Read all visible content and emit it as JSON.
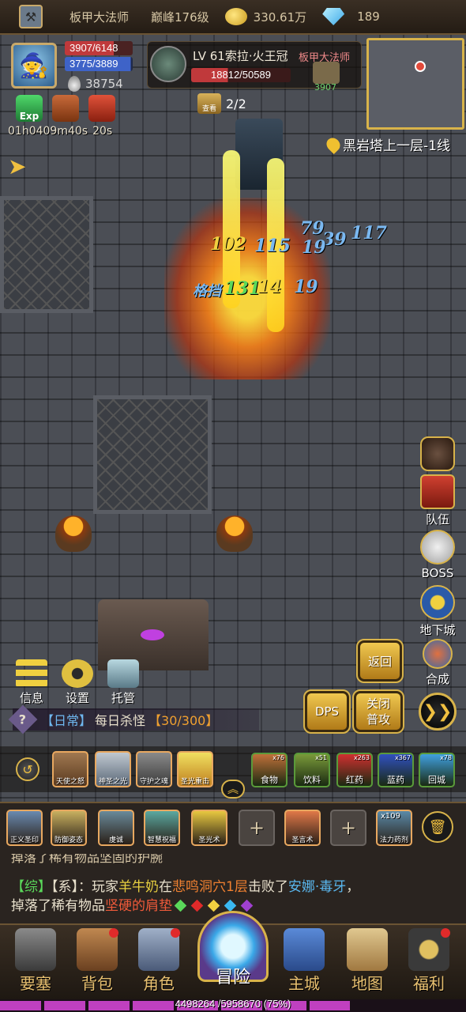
{
  "topbar": {
    "class_name": "板甲大法师",
    "peak_level": "巅峰176级",
    "gold": "330.61万",
    "diamonds": "189"
  },
  "player": {
    "hp": "3907/6148",
    "mp": "3775/3889",
    "power": "38754"
  },
  "target": {
    "name": "LV 61索拉·火王冠",
    "class": "板甲大法师",
    "hp": "18812/50589",
    "guard_power": "3907",
    "inspect_label": "查看",
    "inspect_count": "2/2"
  },
  "location": "黑岩塔上一层-1线",
  "buffs": {
    "exp_label": "Exp",
    "timer_1": "01h04",
    "timer_2": "09m40s",
    "timer_3": "20s"
  },
  "damage_numbers": [
    "79",
    "102",
    "115",
    "39",
    "117",
    "19",
    "格挡",
    "131",
    "14",
    "19"
  ],
  "side_menu": {
    "chat": "聊天",
    "team": "队伍",
    "boss": "BOSS",
    "dungeon": "地下城",
    "craft": "合成"
  },
  "left_menu": {
    "info": "信息",
    "settings": "设置",
    "auto": "托管"
  },
  "actions": {
    "return": "返回",
    "dps": "DPS",
    "normal_attack_l1": "关闭",
    "normal_attack_l2": "普攻"
  },
  "quest": {
    "icon": "?",
    "tag": "【日常】",
    "title": "每日杀怪",
    "progress": "【30/300】"
  },
  "skills_row1": [
    "天使之怒",
    "神圣之光",
    "守护之魂",
    "圣光重击"
  ],
  "consumables": [
    {
      "label": "食物",
      "count": "x76",
      "color": "#c0703a"
    },
    {
      "label": "饮料",
      "count": "x51",
      "color": "#7a9a3a"
    },
    {
      "label": "红药",
      "count": "x263",
      "color": "#d03030"
    },
    {
      "label": "蓝药",
      "count": "x367",
      "color": "#3050c0"
    },
    {
      "label": "回城",
      "count": "x78",
      "color": "#40a0e0"
    }
  ],
  "skills_row2": [
    {
      "label": "正义圣印",
      "empty": false,
      "color": "#6a8ab0"
    },
    {
      "label": "防御姿态",
      "empty": false,
      "color": "#c8b060"
    },
    {
      "label": "虔诚",
      "empty": false,
      "color": "#6a8a9a"
    },
    {
      "label": "智慧祝福",
      "empty": false,
      "color": "#5aa8a0"
    },
    {
      "label": "圣光术",
      "empty": false,
      "color": "#e8c840"
    },
    {
      "label": "+",
      "empty": true,
      "color": ""
    },
    {
      "label": "圣言术",
      "empty": false,
      "color": "#e07848"
    },
    {
      "label": "+",
      "empty": true,
      "color": ""
    },
    {
      "label": "法力药剂",
      "empty": false,
      "count": "x109",
      "color": "#5a8aa8"
    }
  ],
  "chat": {
    "partial_line": "掉落了稀有物品坚固的护腕",
    "channel": "【综】",
    "system": "【系】",
    "sep": "：",
    "pre": "玩家",
    "player_name": "羊牛奶",
    "at": "在",
    "map": "悲鸣洞穴1层",
    "defeated": "击败了",
    "boss": "安娜·毒牙",
    "comma": "，",
    "drop_text": "掉落了稀有物品",
    "item": "坚硬的肩垫",
    "gem_colors": [
      "#5ad85a",
      "#e02a2a",
      "#f0d040",
      "#3ab8f0",
      "#a040d0"
    ]
  },
  "nav": {
    "fortress": "要塞",
    "bag": "背包",
    "character": "角色",
    "adventure": "冒险",
    "city": "主城",
    "map": "地图",
    "welfare": "福利"
  },
  "exp": {
    "text": "4498264 /5958670 (75%)",
    "fraction": 0.75
  }
}
